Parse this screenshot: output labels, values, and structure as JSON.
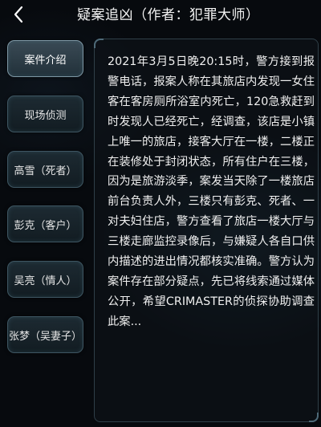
{
  "header": {
    "back_icon": "chevron-left-icon",
    "title": "疑案追凶（作者：犯罪大师）"
  },
  "sidebar": {
    "items": [
      {
        "label": "案件介绍",
        "active": true
      },
      {
        "label": "现场侦测",
        "active": false
      },
      {
        "label": "高雪（死者）",
        "active": false
      },
      {
        "label": "彭克（客户）",
        "active": false
      },
      {
        "label": "吴亮（情人）",
        "active": false
      },
      {
        "label": "张梦（吴妻子）",
        "active": false
      }
    ]
  },
  "content": {
    "text": "2021年3月5日晚20:15时，警方接到报警电话，报案人称在其旅店内发现一女住客在客房厕所浴室内死亡，120急救赶到时发现人已经死亡，经调查，该店是小镇上唯一的旅店，接客大厅在一楼，二楼正在装修处于封闭状态，所有住户在三楼，因为是旅游淡季，案发当天除了一楼旅店前台负责人外，三楼只有彭克、死者、一对夫妇住店，警方查看了旅店一楼大厅与三楼走廊监控录像后，与嫌疑人各自口供内描述的进出情况都核实准确。警方认为案件存在部分疑点，先已将线索通过媒体公开，希望CRIMASTER的侦探协助调查此案..."
  },
  "colors": {
    "background": "#070a0e",
    "tab_border": "#3e5662",
    "tab_active_border": "#7e97a4",
    "text": "#f0f0f0"
  }
}
